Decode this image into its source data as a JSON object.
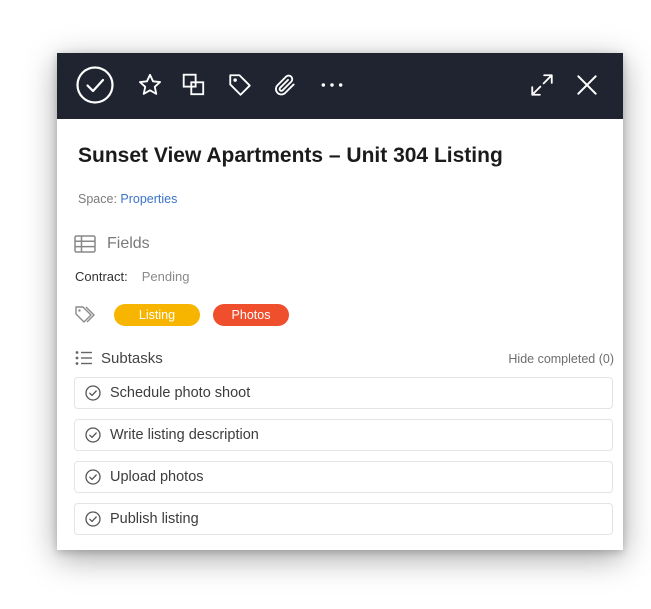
{
  "task": {
    "title": "Sunset View Apartments – Unit 304 Listing",
    "space_label": "Space:",
    "space_value": "Properties"
  },
  "toolbar": {
    "background": "#1f2430",
    "icons": [
      "check-circle-icon",
      "star-icon",
      "copy-icon",
      "tag-icon",
      "paperclip-icon",
      "more-icon",
      "expand-icon",
      "close-icon"
    ]
  },
  "fields": {
    "header": "Fields",
    "contract_label": "Contract:",
    "contract_value": "Pending"
  },
  "tags": [
    {
      "label": "Listing",
      "color": "#f7b500"
    },
    {
      "label": "Photos",
      "color": "#f04f2e"
    }
  ],
  "subtasks": {
    "header": "Subtasks",
    "hide_completed": "Hide completed (0)",
    "items": [
      {
        "label": "Schedule photo shoot"
      },
      {
        "label": "Write listing description"
      },
      {
        "label": "Upload photos"
      },
      {
        "label": "Publish listing"
      }
    ]
  }
}
